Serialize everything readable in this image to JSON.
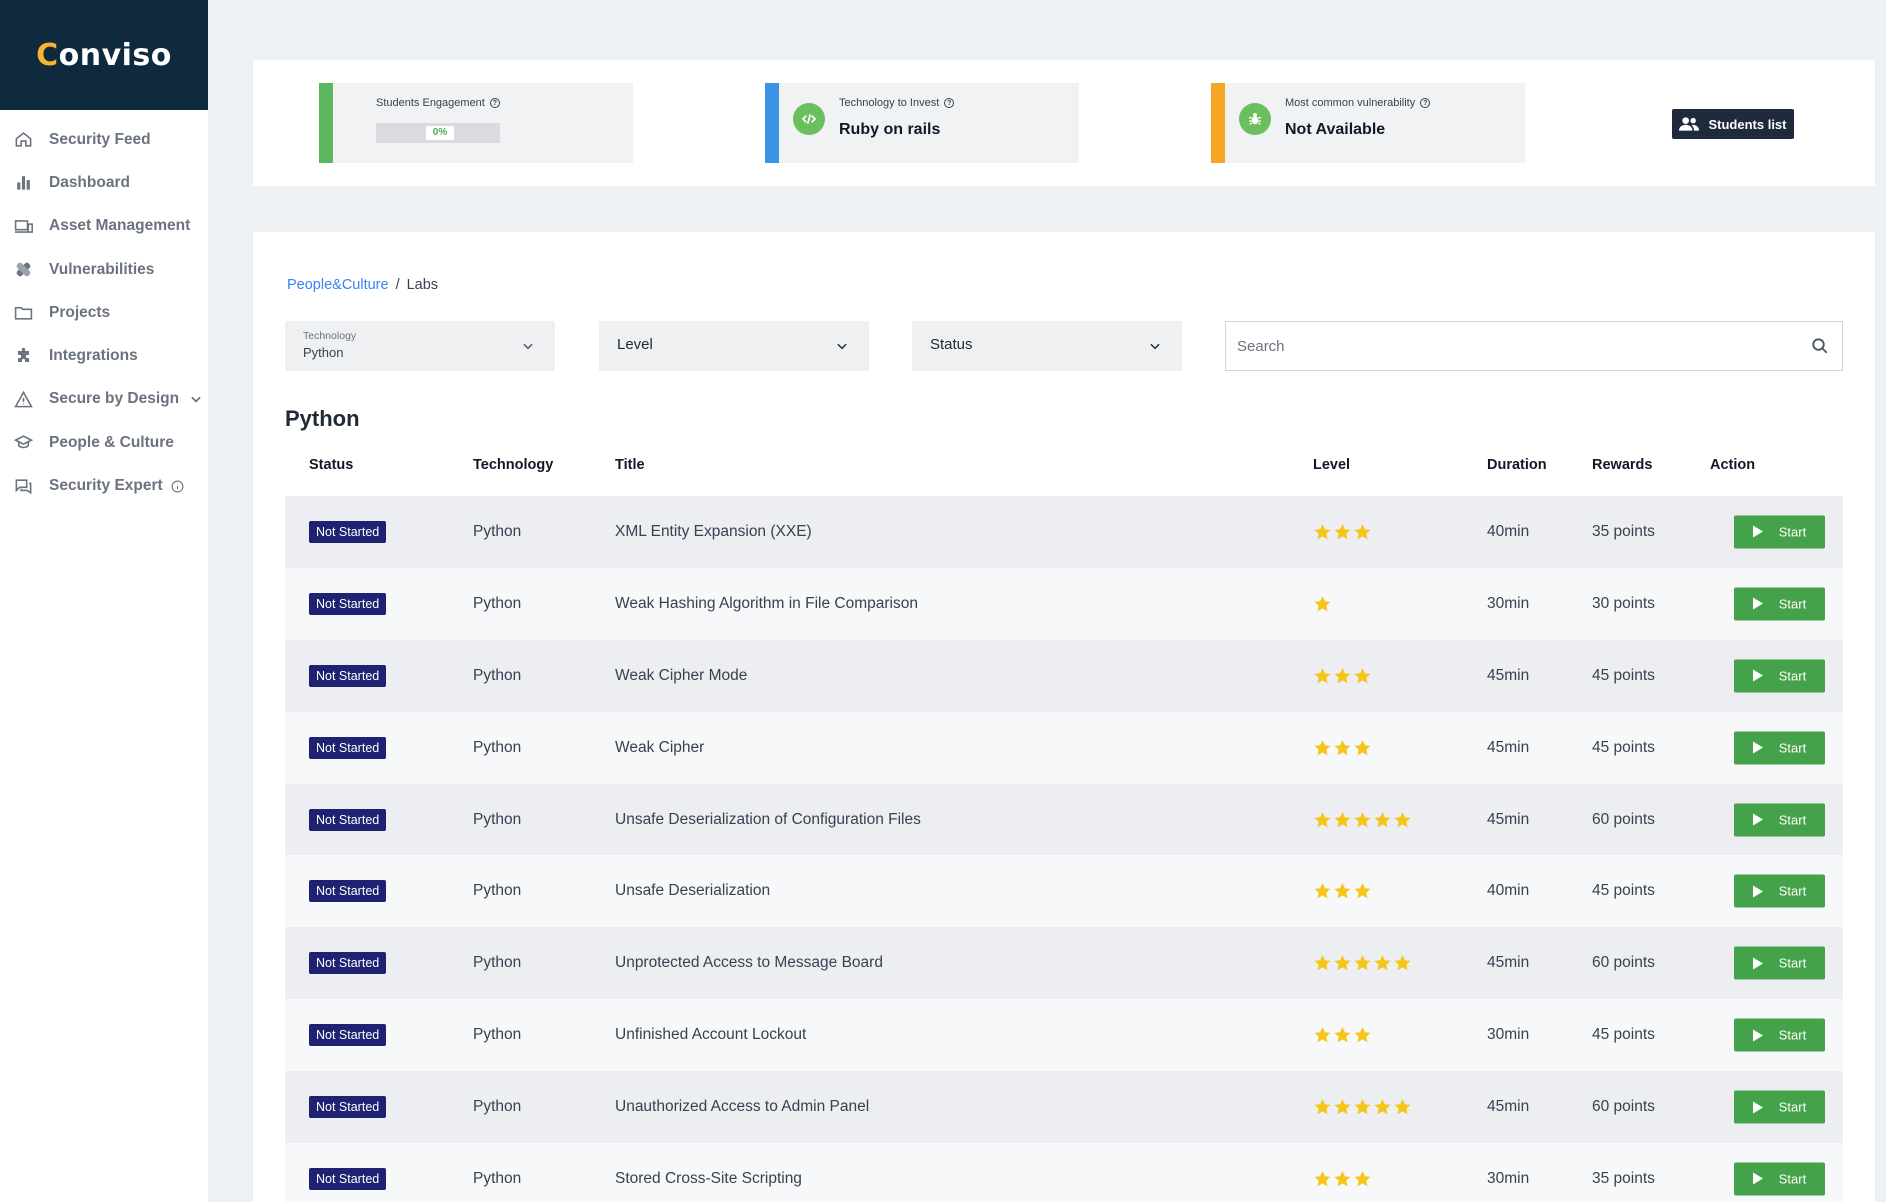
{
  "brand": {
    "logo_text": "onviso",
    "logo_letter": "C"
  },
  "sidebar": {
    "items": [
      {
        "label": "Security Feed",
        "icon": "home-icon"
      },
      {
        "label": "Dashboard",
        "icon": "bar-chart-icon"
      },
      {
        "label": "Asset Management",
        "icon": "devices-icon"
      },
      {
        "label": "Vulnerabilities",
        "icon": "bandage-icon"
      },
      {
        "label": "Projects",
        "icon": "folder-icon"
      },
      {
        "label": "Integrations",
        "icon": "puzzle-icon"
      },
      {
        "label": "Secure by Design",
        "icon": "warning-icon"
      },
      {
        "label": "People & Culture",
        "icon": "graduation-cap-icon"
      },
      {
        "label": "Security Expert",
        "icon": "chat-icon"
      }
    ]
  },
  "stats": {
    "engagement": {
      "label": "Students Engagement",
      "value": "0%",
      "progress_percent": 0,
      "color": "#5cb85c"
    },
    "technology": {
      "label": "Technology to Invest",
      "value": "Ruby on rails",
      "color": "#3b93e6"
    },
    "vulnerability": {
      "label": "Most common vulnerability",
      "value": "Not Available",
      "color": "#f5a623"
    },
    "students_button": "Students list"
  },
  "breadcrumb": {
    "parent": "People&Culture",
    "separator": "/",
    "current": "Labs"
  },
  "filters": {
    "technology": {
      "label": "Technology",
      "value": "Python"
    },
    "level": {
      "label": "Level"
    },
    "status": {
      "label": "Status"
    },
    "search_placeholder": "Search"
  },
  "section_title": "Python",
  "table": {
    "headers": {
      "status": "Status",
      "technology": "Technology",
      "title": "Title",
      "level": "Level",
      "duration": "Duration",
      "rewards": "Rewards",
      "action": "Action"
    },
    "rows": [
      {
        "status": "Not Started",
        "technology": "Python",
        "title": "XML Entity Expansion (XXE)",
        "stars": 3,
        "duration": "40min",
        "rewards": "35 points",
        "action": "Start"
      },
      {
        "status": "Not Started",
        "technology": "Python",
        "title": "Weak Hashing Algorithm in File Comparison",
        "stars": 1,
        "duration": "30min",
        "rewards": "30 points",
        "action": "Start"
      },
      {
        "status": "Not Started",
        "technology": "Python",
        "title": "Weak Cipher Mode",
        "stars": 3,
        "duration": "45min",
        "rewards": "45 points",
        "action": "Start"
      },
      {
        "status": "Not Started",
        "technology": "Python",
        "title": "Weak Cipher",
        "stars": 3,
        "duration": "45min",
        "rewards": "45 points",
        "action": "Start"
      },
      {
        "status": "Not Started",
        "technology": "Python",
        "title": "Unsafe Deserialization of Configuration Files",
        "stars": 5,
        "duration": "45min",
        "rewards": "60 points",
        "action": "Start"
      },
      {
        "status": "Not Started",
        "technology": "Python",
        "title": "Unsafe Deserialization",
        "stars": 3,
        "duration": "40min",
        "rewards": "45 points",
        "action": "Start"
      },
      {
        "status": "Not Started",
        "technology": "Python",
        "title": "Unprotected Access to Message Board",
        "stars": 5,
        "duration": "45min",
        "rewards": "60 points",
        "action": "Start"
      },
      {
        "status": "Not Started",
        "technology": "Python",
        "title": "Unfinished Account Lockout",
        "stars": 3,
        "duration": "30min",
        "rewards": "45 points",
        "action": "Start"
      },
      {
        "status": "Not Started",
        "technology": "Python",
        "title": "Unauthorized Access to Admin Panel",
        "stars": 5,
        "duration": "45min",
        "rewards": "60 points",
        "action": "Start"
      },
      {
        "status": "Not Started",
        "technology": "Python",
        "title": "Stored Cross-Site Scripting",
        "stars": 3,
        "duration": "30min",
        "rewards": "35 points",
        "action": "Start"
      }
    ]
  },
  "colors": {
    "sidebar_logo_bg": "#0f2a3d",
    "badge_bg": "#1e2270",
    "start_button": "#43a24a",
    "star": "#f5c518",
    "link": "#3b82f6"
  }
}
